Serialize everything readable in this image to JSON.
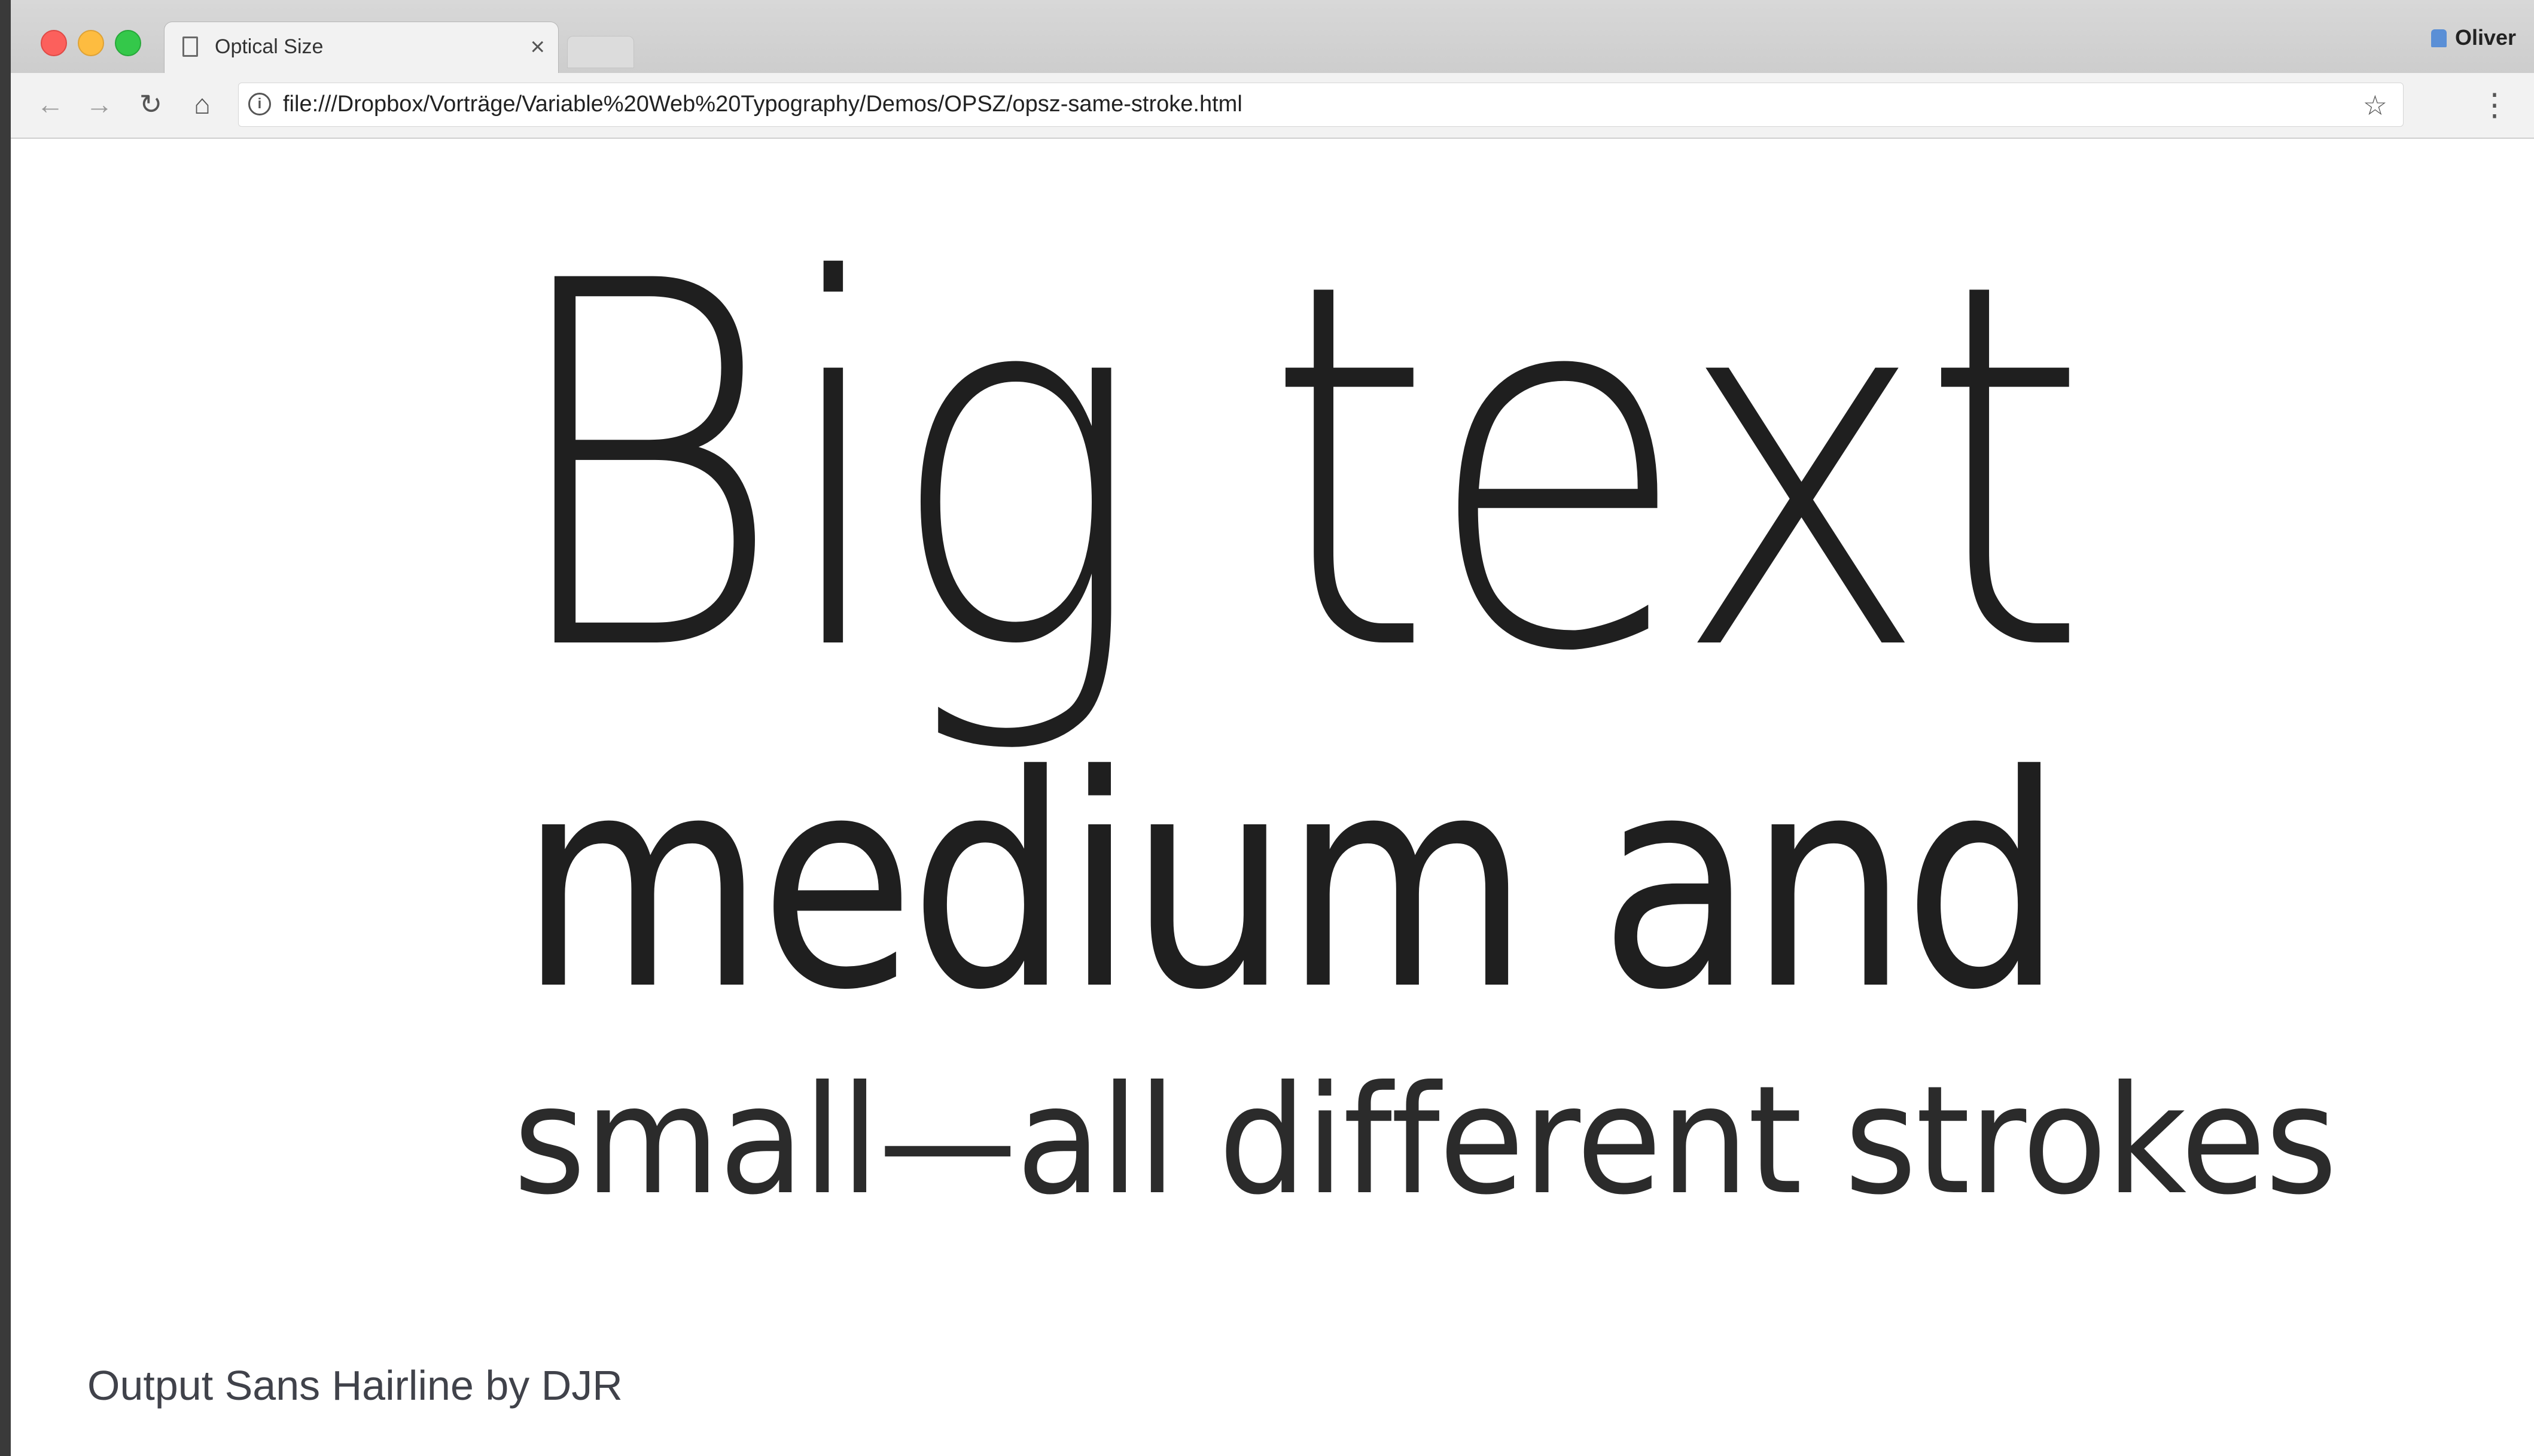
{
  "browser": {
    "tab": {
      "title": "Optical Size",
      "close_glyph": "×",
      "icon": "document-icon"
    },
    "profile": {
      "name": "Oliver",
      "icon": "person-icon"
    },
    "toolbar": {
      "back_glyph": "←",
      "forward_glyph": "→",
      "reload_glyph": "↻",
      "home_glyph": "⌂",
      "info_glyph": "i",
      "url": "file:///Dropbox/Vorträge/Variable%20Web%20Typography/Demos/OPSZ/opsz-same-stroke.html",
      "star_glyph": "☆",
      "menu_glyph": "⋮"
    }
  },
  "page": {
    "line_big": "Big text",
    "line_medium": "medium and",
    "line_small": "small—all different strokes"
  },
  "caption": "Output Sans Hairline by DJR",
  "colors": {
    "window_frame": "#3a3a3a",
    "text": "#1f1f1f",
    "caption": "#40424a",
    "traffic_red": "#fc605c",
    "traffic_yellow": "#fdbc40",
    "traffic_green": "#34c84a"
  }
}
